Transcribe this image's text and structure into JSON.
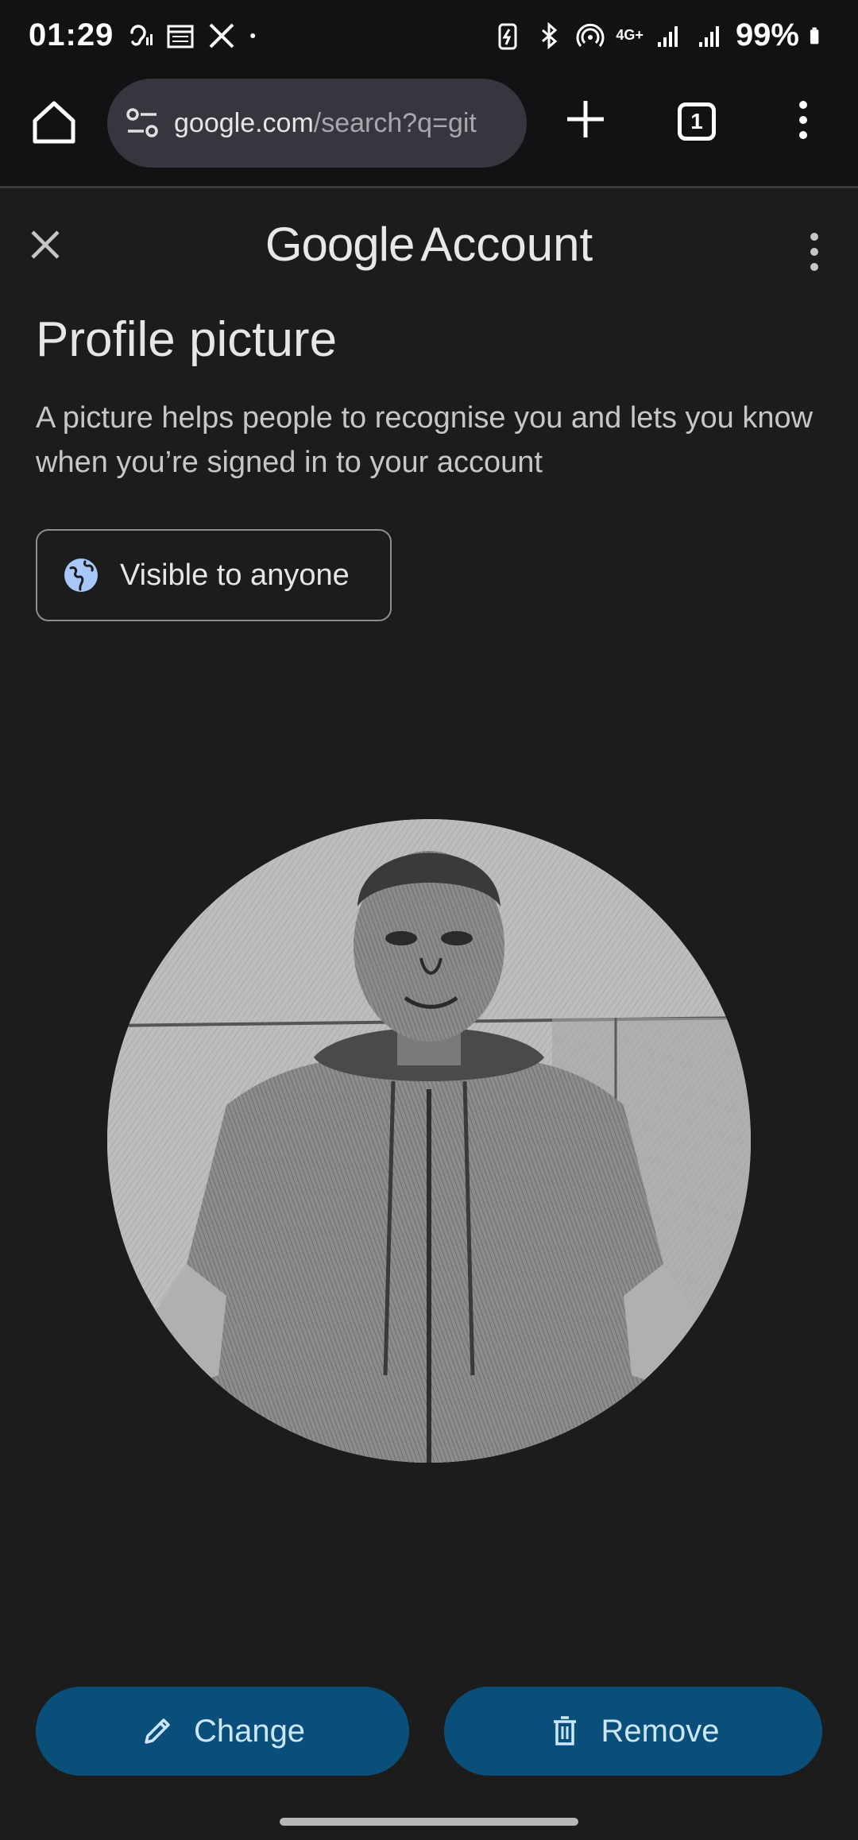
{
  "status_bar": {
    "time": "01:29",
    "network": "4G+",
    "battery": "99%",
    "icons": [
      "hearing-icon",
      "calendar-icon",
      "x-logo-icon",
      "dot-icon",
      "battery-saver-icon",
      "bluetooth-icon",
      "hotspot-icon",
      "signal-icon",
      "signal-icon",
      "battery-icon"
    ]
  },
  "browser": {
    "url_domain": "google.com",
    "url_path": "/search?q=git",
    "tab_count": "1"
  },
  "header": {
    "brand_google": "Google",
    "brand_account": "Account"
  },
  "page": {
    "title": "Profile picture",
    "description": "A picture helps people to recognise you and lets you know when you’re signed in to your account",
    "visibility_label": "Visible to anyone"
  },
  "actions": {
    "change_label": "Change",
    "remove_label": "Remove"
  },
  "colors": {
    "background": "#1c1c1c",
    "toolbar": "#111214",
    "button_bg": "#0a4f7a",
    "button_text": "#cde6ff",
    "globe_accent": "#a8c7fa"
  }
}
